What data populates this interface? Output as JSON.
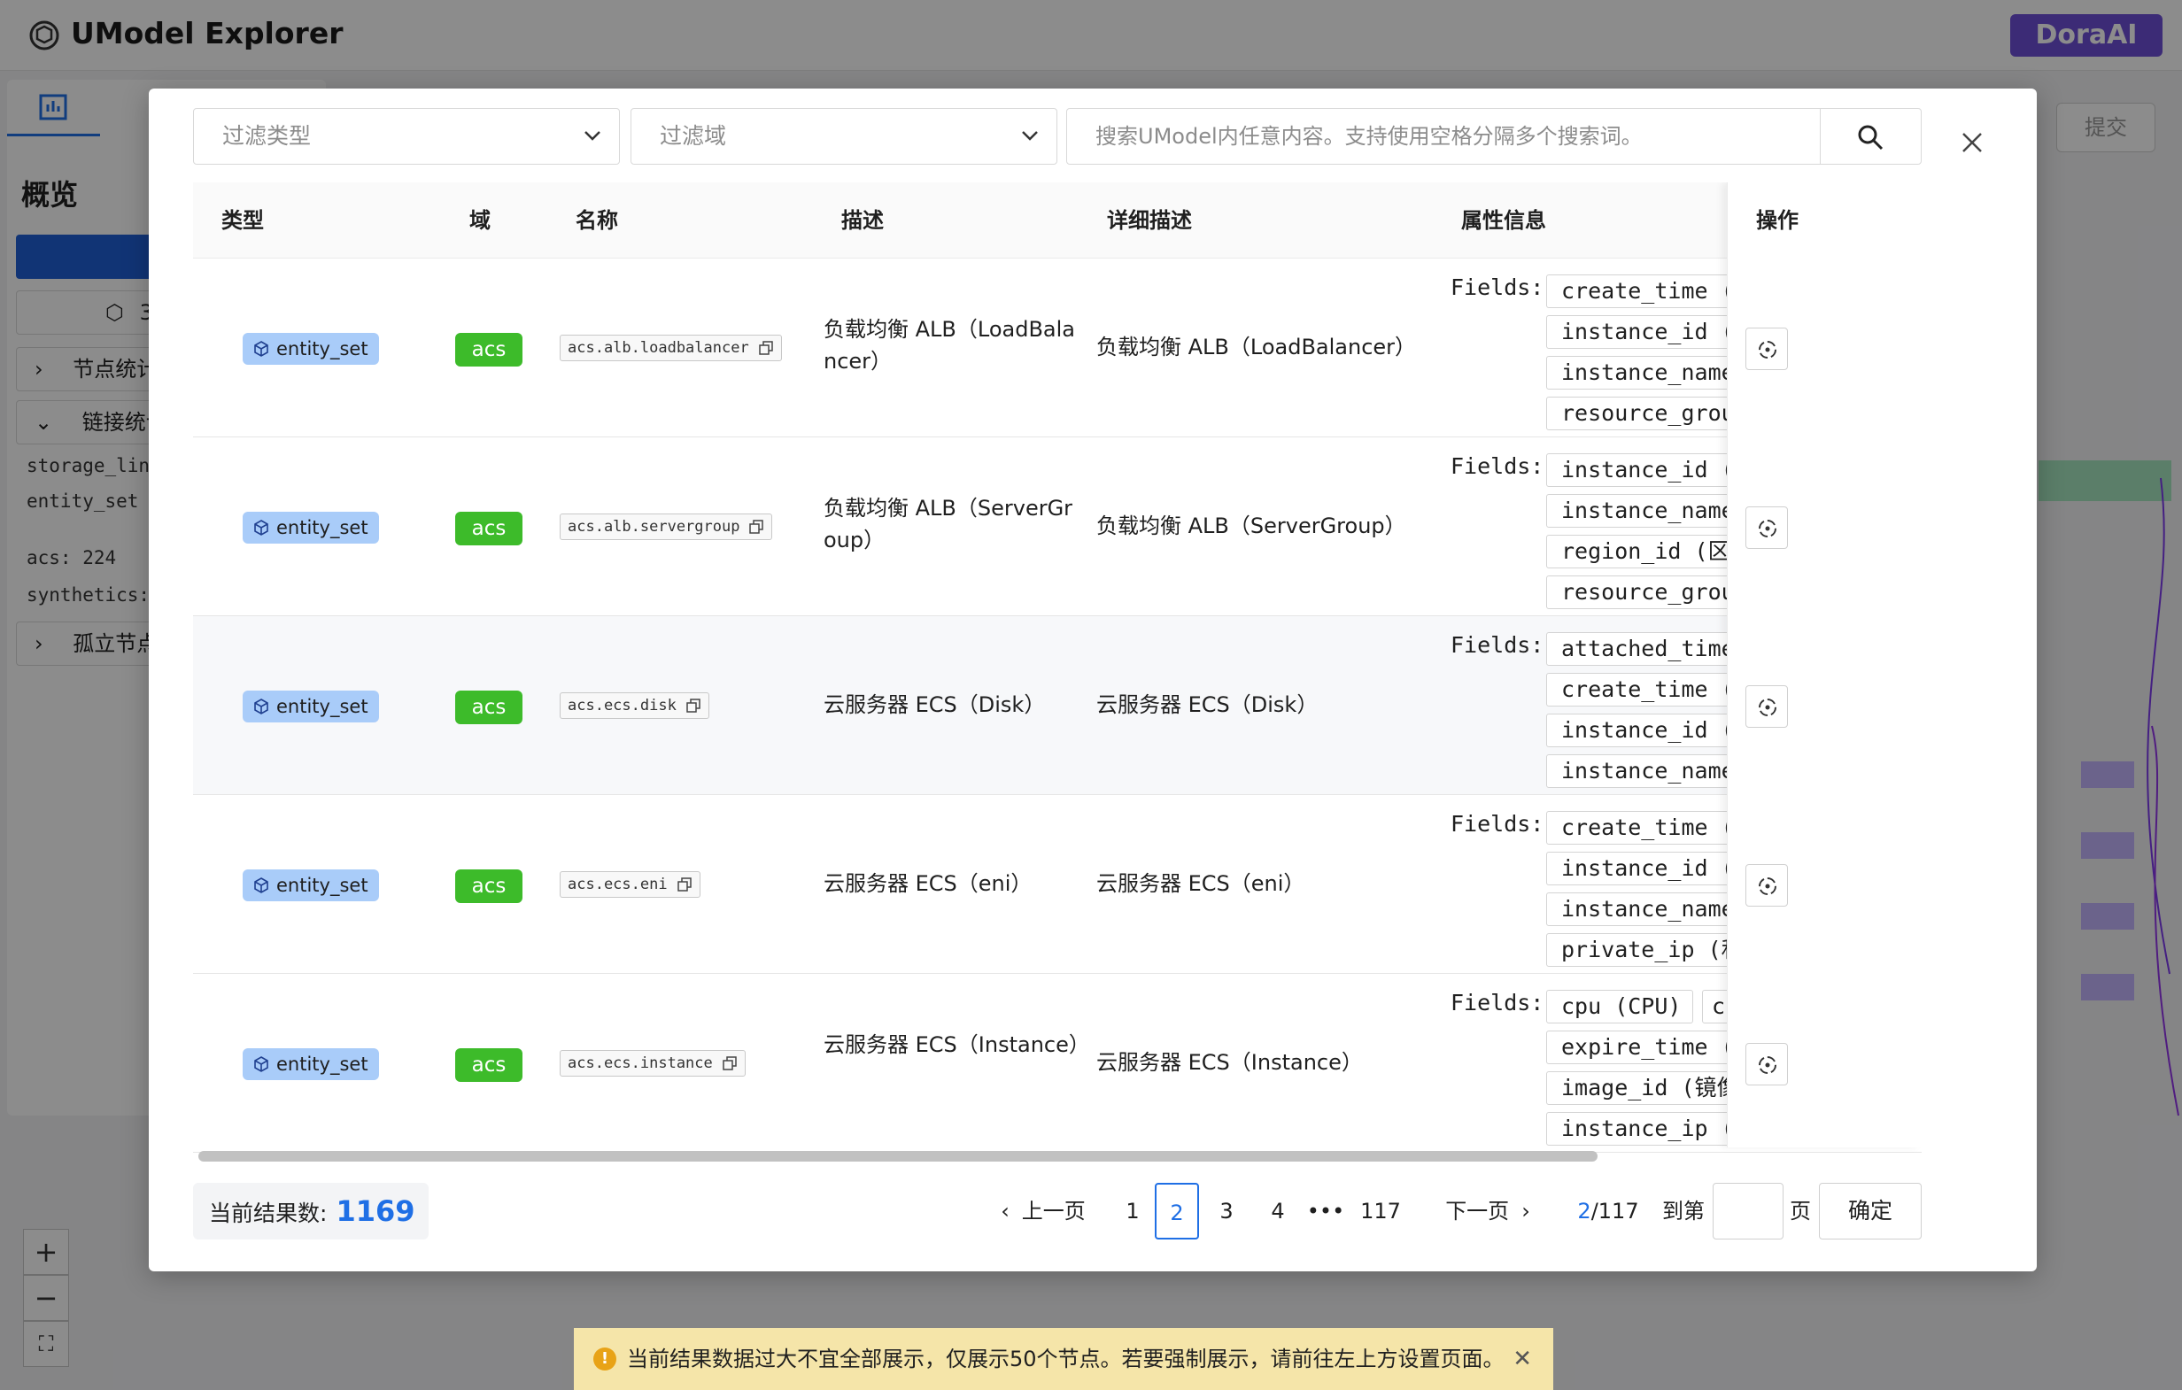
{
  "app": {
    "title": "UModel Explorer",
    "brand_button": "DoraAI",
    "submit_label": "提交"
  },
  "sidebar": {
    "overview_title": "概览",
    "rows": [
      "节点统计",
      "链接统计",
      "孤立节点"
    ],
    "texts": [
      "storage_link",
      "entity_set",
      "acs: 224",
      "synthetics:"
    ],
    "box_label": "3"
  },
  "warning": {
    "text": "当前结果数据过大不宜全部展示，仅展示50个节点。若要强制展示，请前往左上方设置页面。"
  },
  "filters": {
    "type_placeholder": "过滤类型",
    "domain_placeholder": "过滤域",
    "search_placeholder": "搜索UModel内任意内容。支持使用空格分隔多个搜索词。"
  },
  "table": {
    "headers": [
      "类型",
      "域",
      "名称",
      "描述",
      "详细描述",
      "属性信息",
      "操作"
    ],
    "fields_label": "Fields:",
    "rows": [
      {
        "type": "entity_set",
        "domain": "acs",
        "name": "acs.alb.loadbalancer",
        "description": "负载均衡 ALB（LoadBalancer）",
        "detail": "负载均衡 ALB（LoadBalancer）",
        "fields": [
          "create_time (",
          "instance_id (",
          "instance_name",
          "resource_grou"
        ]
      },
      {
        "type": "entity_set",
        "domain": "acs",
        "name": "acs.alb.servergroup",
        "description": "负载均衡 ALB（ServerGroup）",
        "detail": "负载均衡 ALB（ServerGroup）",
        "fields": [
          "instance_id (",
          "instance_name",
          "region_id (区",
          "resource_grou"
        ]
      },
      {
        "type": "entity_set",
        "domain": "acs",
        "name": "acs.ecs.disk",
        "description": "云服务器 ECS（Disk）",
        "detail": "云服务器 ECS（Disk）",
        "fields": [
          "attached_time",
          "create_time (",
          "instance_id (",
          "instance_name"
        ]
      },
      {
        "type": "entity_set",
        "domain": "acs",
        "name": "acs.ecs.eni",
        "description": "云服务器 ECS（eni）",
        "detail": "云服务器 ECS（eni）",
        "fields": [
          "create_time (",
          "instance_id (",
          "instance_name",
          "private_ip (私"
        ]
      },
      {
        "type": "entity_set",
        "domain": "acs",
        "name": "acs.ecs.instance",
        "description": "云服务器 ECS（Instance）",
        "detail": "云服务器 ECS（Instance）",
        "fields": [
          "cpu (CPU)",
          "c",
          "expire_time (",
          "image_id (镜像",
          "instance_ip ("
        ]
      }
    ]
  },
  "footer": {
    "result_label": "当前结果数:",
    "result_count": "1169",
    "prev": "上一页",
    "next": "下一页",
    "pages": [
      "1",
      "2",
      "3",
      "4",
      "•••",
      "117"
    ],
    "current_page": "2",
    "total_pages": "/117",
    "goto_label": "到第",
    "page_unit": "页",
    "confirm": "确定"
  }
}
